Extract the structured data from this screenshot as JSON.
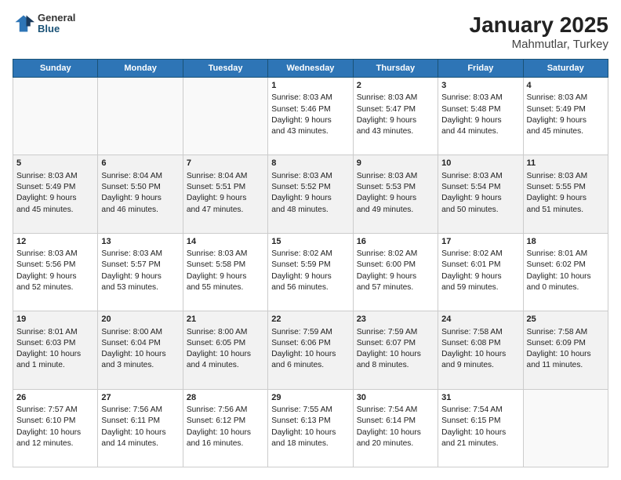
{
  "logo": {
    "general": "General",
    "blue": "Blue"
  },
  "title": "January 2025",
  "subtitle": "Mahmutlar, Turkey",
  "weekdays": [
    "Sunday",
    "Monday",
    "Tuesday",
    "Wednesday",
    "Thursday",
    "Friday",
    "Saturday"
  ],
  "weeks": [
    [
      {
        "day": "",
        "content": ""
      },
      {
        "day": "",
        "content": ""
      },
      {
        "day": "",
        "content": ""
      },
      {
        "day": "1",
        "content": "Sunrise: 8:03 AM\nSunset: 5:46 PM\nDaylight: 9 hours\nand 43 minutes."
      },
      {
        "day": "2",
        "content": "Sunrise: 8:03 AM\nSunset: 5:47 PM\nDaylight: 9 hours\nand 43 minutes."
      },
      {
        "day": "3",
        "content": "Sunrise: 8:03 AM\nSunset: 5:48 PM\nDaylight: 9 hours\nand 44 minutes."
      },
      {
        "day": "4",
        "content": "Sunrise: 8:03 AM\nSunset: 5:49 PM\nDaylight: 9 hours\nand 45 minutes."
      }
    ],
    [
      {
        "day": "5",
        "content": "Sunrise: 8:03 AM\nSunset: 5:49 PM\nDaylight: 9 hours\nand 45 minutes."
      },
      {
        "day": "6",
        "content": "Sunrise: 8:04 AM\nSunset: 5:50 PM\nDaylight: 9 hours\nand 46 minutes."
      },
      {
        "day": "7",
        "content": "Sunrise: 8:04 AM\nSunset: 5:51 PM\nDaylight: 9 hours\nand 47 minutes."
      },
      {
        "day": "8",
        "content": "Sunrise: 8:03 AM\nSunset: 5:52 PM\nDaylight: 9 hours\nand 48 minutes."
      },
      {
        "day": "9",
        "content": "Sunrise: 8:03 AM\nSunset: 5:53 PM\nDaylight: 9 hours\nand 49 minutes."
      },
      {
        "day": "10",
        "content": "Sunrise: 8:03 AM\nSunset: 5:54 PM\nDaylight: 9 hours\nand 50 minutes."
      },
      {
        "day": "11",
        "content": "Sunrise: 8:03 AM\nSunset: 5:55 PM\nDaylight: 9 hours\nand 51 minutes."
      }
    ],
    [
      {
        "day": "12",
        "content": "Sunrise: 8:03 AM\nSunset: 5:56 PM\nDaylight: 9 hours\nand 52 minutes."
      },
      {
        "day": "13",
        "content": "Sunrise: 8:03 AM\nSunset: 5:57 PM\nDaylight: 9 hours\nand 53 minutes."
      },
      {
        "day": "14",
        "content": "Sunrise: 8:03 AM\nSunset: 5:58 PM\nDaylight: 9 hours\nand 55 minutes."
      },
      {
        "day": "15",
        "content": "Sunrise: 8:02 AM\nSunset: 5:59 PM\nDaylight: 9 hours\nand 56 minutes."
      },
      {
        "day": "16",
        "content": "Sunrise: 8:02 AM\nSunset: 6:00 PM\nDaylight: 9 hours\nand 57 minutes."
      },
      {
        "day": "17",
        "content": "Sunrise: 8:02 AM\nSunset: 6:01 PM\nDaylight: 9 hours\nand 59 minutes."
      },
      {
        "day": "18",
        "content": "Sunrise: 8:01 AM\nSunset: 6:02 PM\nDaylight: 10 hours\nand 0 minutes."
      }
    ],
    [
      {
        "day": "19",
        "content": "Sunrise: 8:01 AM\nSunset: 6:03 PM\nDaylight: 10 hours\nand 1 minute."
      },
      {
        "day": "20",
        "content": "Sunrise: 8:00 AM\nSunset: 6:04 PM\nDaylight: 10 hours\nand 3 minutes."
      },
      {
        "day": "21",
        "content": "Sunrise: 8:00 AM\nSunset: 6:05 PM\nDaylight: 10 hours\nand 4 minutes."
      },
      {
        "day": "22",
        "content": "Sunrise: 7:59 AM\nSunset: 6:06 PM\nDaylight: 10 hours\nand 6 minutes."
      },
      {
        "day": "23",
        "content": "Sunrise: 7:59 AM\nSunset: 6:07 PM\nDaylight: 10 hours\nand 8 minutes."
      },
      {
        "day": "24",
        "content": "Sunrise: 7:58 AM\nSunset: 6:08 PM\nDaylight: 10 hours\nand 9 minutes."
      },
      {
        "day": "25",
        "content": "Sunrise: 7:58 AM\nSunset: 6:09 PM\nDaylight: 10 hours\nand 11 minutes."
      }
    ],
    [
      {
        "day": "26",
        "content": "Sunrise: 7:57 AM\nSunset: 6:10 PM\nDaylight: 10 hours\nand 12 minutes."
      },
      {
        "day": "27",
        "content": "Sunrise: 7:56 AM\nSunset: 6:11 PM\nDaylight: 10 hours\nand 14 minutes."
      },
      {
        "day": "28",
        "content": "Sunrise: 7:56 AM\nSunset: 6:12 PM\nDaylight: 10 hours\nand 16 minutes."
      },
      {
        "day": "29",
        "content": "Sunrise: 7:55 AM\nSunset: 6:13 PM\nDaylight: 10 hours\nand 18 minutes."
      },
      {
        "day": "30",
        "content": "Sunrise: 7:54 AM\nSunset: 6:14 PM\nDaylight: 10 hours\nand 20 minutes."
      },
      {
        "day": "31",
        "content": "Sunrise: 7:54 AM\nSunset: 6:15 PM\nDaylight: 10 hours\nand 21 minutes."
      },
      {
        "day": "",
        "content": ""
      }
    ]
  ]
}
